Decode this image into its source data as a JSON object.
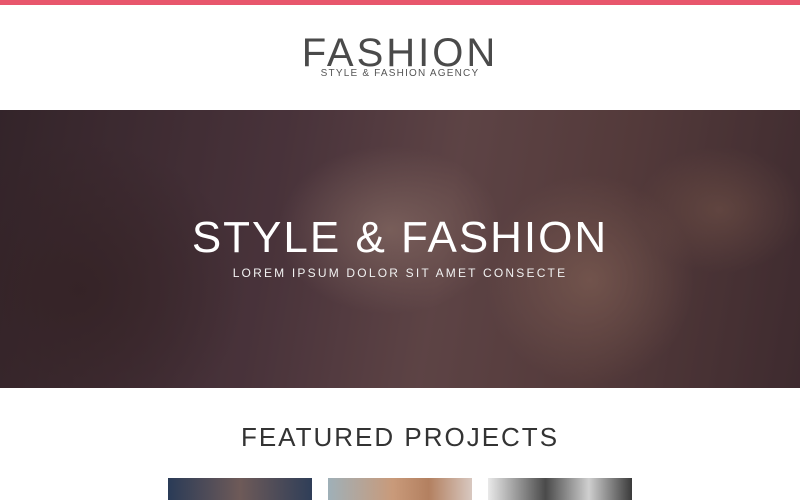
{
  "header": {
    "logo_title": "FASHION",
    "logo_tagline": "STYLE & FASHION AGENCY",
    "accent_color": "#e8566c"
  },
  "hero": {
    "title": "STYLE & FASHION",
    "subtitle": "LOREM IPSUM DOLOR SIT AMET CONSECTE"
  },
  "featured": {
    "title": "FEATURED PROJECTS"
  }
}
